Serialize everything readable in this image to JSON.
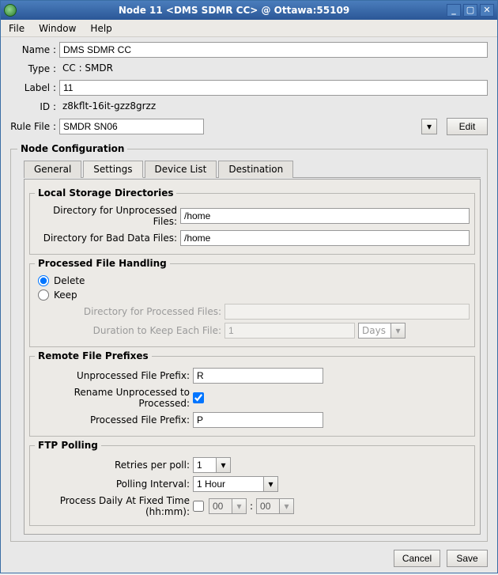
{
  "window": {
    "title": "Node 11 <DMS SDMR CC> @ Ottawa:55109"
  },
  "menu": {
    "file": "File",
    "window": "Window",
    "help": "Help"
  },
  "form": {
    "name_lbl": "Name :",
    "name": "DMS SDMR CC",
    "type_lbl": "Type :",
    "type": "CC : SMDR",
    "label_lbl": "Label :",
    "label": "11",
    "id_lbl": "ID :",
    "id": "z8kflt-16it-gzz8grzz",
    "rulefile_lbl": "Rule File :",
    "rulefile": "SMDR SN06",
    "edit_btn": "Edit"
  },
  "panel": {
    "title": "Node Configuration"
  },
  "tabs": {
    "general": "General",
    "settings": "Settings",
    "devicelist": "Device List",
    "destination": "Destination"
  },
  "localdirs": {
    "legend": "Local Storage Directories",
    "unproc_lbl": "Directory for Unprocessed Files:",
    "unproc": "/home",
    "bad_lbl": "Directory for Bad Data Files:",
    "bad": "/home"
  },
  "processed": {
    "legend": "Processed File Handling",
    "delete": "Delete",
    "keep": "Keep",
    "dir_lbl": "Directory for Processed Files:",
    "dir": "",
    "dur_lbl": "Duration to Keep Each File:",
    "dur": "1",
    "dur_unit": "Days"
  },
  "remote": {
    "legend": "Remote File Prefixes",
    "unproc_lbl": "Unprocessed File Prefix:",
    "unproc": "R",
    "rename_lbl": "Rename Unprocessed to Processed:",
    "rename": true,
    "proc_lbl": "Processed File Prefix:",
    "proc": "P"
  },
  "ftp": {
    "legend": "FTP Polling",
    "retries_lbl": "Retries per poll:",
    "retries": "1",
    "interval_lbl": "Polling Interval:",
    "interval": "1 Hour",
    "fixed_lbl": "Process Daily At Fixed Time (hh:mm):",
    "fixed_checked": false,
    "fixed_hh": "00",
    "fixed_mm": "00",
    "colon": ":"
  },
  "footer": {
    "cancel": "Cancel",
    "save": "Save"
  }
}
